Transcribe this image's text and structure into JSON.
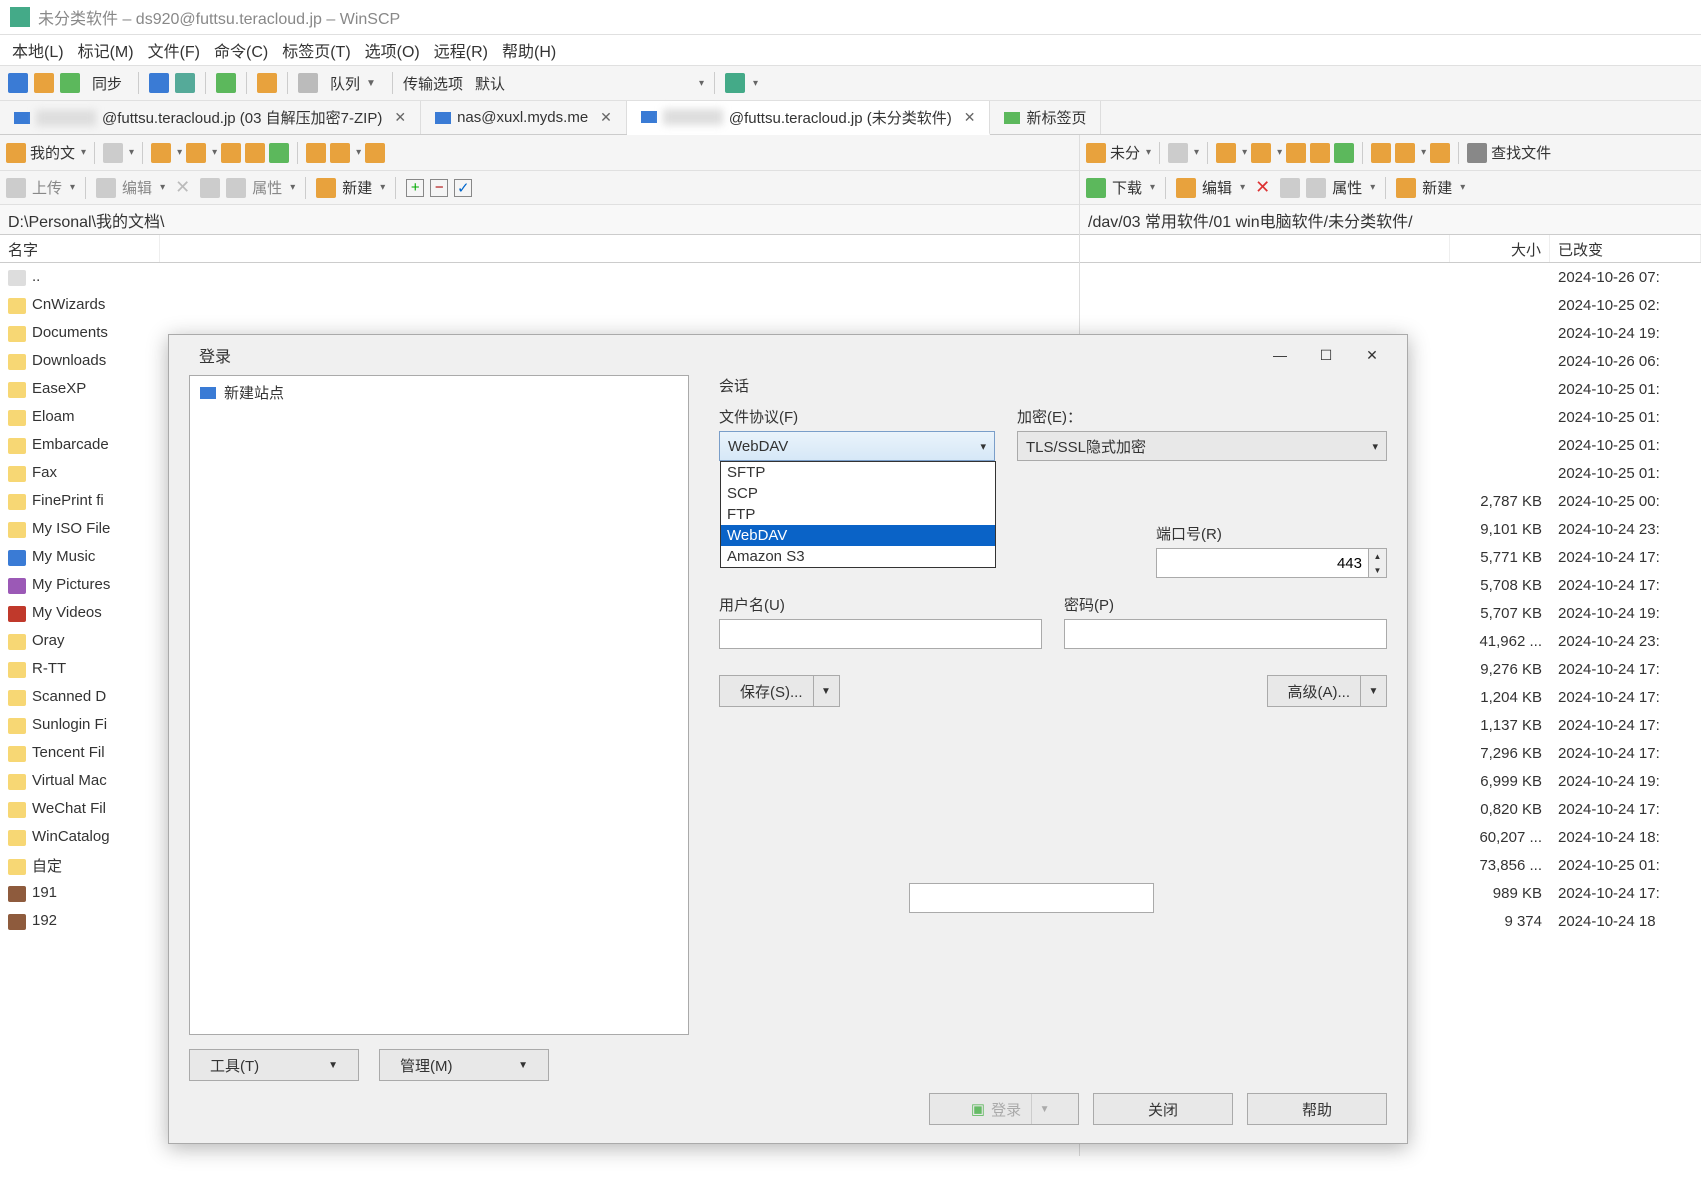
{
  "window": {
    "title": "未分类软件 – ds920@futtsu.teracloud.jp – WinSCP"
  },
  "menu": [
    "本地(L)",
    "标记(M)",
    "文件(F)",
    "命令(C)",
    "标签页(T)",
    "选项(O)",
    "远程(R)",
    "帮助(H)"
  ],
  "toolbar": {
    "sync": "同步",
    "queue": "队列",
    "transfer_opts": "传输选项",
    "transfer_default": "默认"
  },
  "tabs": [
    {
      "label": "@futtsu.teracloud.jp (03 自解压加密7-ZIP)",
      "active": false,
      "closable": true
    },
    {
      "label": "nas@xuxl.myds.me",
      "active": false,
      "closable": true
    },
    {
      "label": "@futtsu.teracloud.jp (未分类软件)",
      "active": true,
      "closable": true
    },
    {
      "label": "新标签页",
      "active": false,
      "closable": false
    }
  ],
  "left": {
    "drive_label": "我的文",
    "upload": "上传",
    "edit": "编辑",
    "props": "属性",
    "new": "新建",
    "path": "D:\\Personal\\我的文档\\",
    "col_name": "名字",
    "files": [
      {
        "name": "..",
        "icon": "up"
      },
      {
        "name": "CnWizards",
        "icon": "folder"
      },
      {
        "name": "Documents",
        "icon": "folder"
      },
      {
        "name": "Downloads",
        "icon": "folder"
      },
      {
        "name": "EaseXP",
        "icon": "folder"
      },
      {
        "name": "Eloam",
        "icon": "folder"
      },
      {
        "name": "Embarcade",
        "icon": "folder"
      },
      {
        "name": "Fax",
        "icon": "folder"
      },
      {
        "name": "FinePrint fi",
        "icon": "folder"
      },
      {
        "name": "My ISO File",
        "icon": "folder"
      },
      {
        "name": "My Music",
        "icon": "music"
      },
      {
        "name": "My Pictures",
        "icon": "img"
      },
      {
        "name": "My Videos",
        "icon": "video"
      },
      {
        "name": "Oray",
        "icon": "folder"
      },
      {
        "name": "R-TT",
        "icon": "folder"
      },
      {
        "name": "Scanned D",
        "icon": "folder"
      },
      {
        "name": "Sunlogin Fi",
        "icon": "folder"
      },
      {
        "name": "Tencent Fil",
        "icon": "folder"
      },
      {
        "name": "Virtual Mac",
        "icon": "folder"
      },
      {
        "name": "WeChat Fil",
        "icon": "folder"
      },
      {
        "name": "WinCatalog",
        "icon": "folder"
      },
      {
        "name": "自定",
        "icon": "folder"
      },
      {
        "name": "191",
        "icon": "jpg"
      },
      {
        "name": "192",
        "icon": "jpg"
      }
    ]
  },
  "right": {
    "drive_label": "未分",
    "find": "查找文件",
    "download": "下载",
    "edit": "编辑",
    "props": "属性",
    "new": "新建",
    "path": "/dav/03 常用软件/01 win电脑软件/未分类软件/",
    "col_size": "大小",
    "col_modified": "已改变",
    "rows": [
      {
        "size": "",
        "modified": "2024-10-26 07:"
      },
      {
        "size": "",
        "modified": "2024-10-25 02:"
      },
      {
        "size": "",
        "modified": "2024-10-24 19:"
      },
      {
        "size": "",
        "modified": "2024-10-26 06:"
      },
      {
        "size": "",
        "modified": "2024-10-25 01:"
      },
      {
        "size": "",
        "modified": "2024-10-25 01:"
      },
      {
        "size": "",
        "modified": "2024-10-25 01:"
      },
      {
        "size": "",
        "modified": "2024-10-25 01:"
      },
      {
        "size": "2,787 KB",
        "modified": "2024-10-25 00:"
      },
      {
        "size": "9,101 KB",
        "modified": "2024-10-24 23:"
      },
      {
        "size": "5,771 KB",
        "modified": "2024-10-24 17:"
      },
      {
        "size": "5,708 KB",
        "modified": "2024-10-24 17:"
      },
      {
        "size": "5,707 KB",
        "modified": "2024-10-24 19:"
      },
      {
        "size": "41,962 ...",
        "modified": "2024-10-24 23:"
      },
      {
        "size": "9,276 KB",
        "modified": "2024-10-24 17:"
      },
      {
        "size": "1,204 KB",
        "modified": "2024-10-24 17:"
      },
      {
        "size": "1,137 KB",
        "modified": "2024-10-24 17:"
      },
      {
        "size": "7,296 KB",
        "modified": "2024-10-24 17:"
      },
      {
        "size": "6,999 KB",
        "modified": "2024-10-24 19:"
      },
      {
        "size": "0,820 KB",
        "modified": "2024-10-24 17:"
      },
      {
        "size": "60,207 ...",
        "modified": "2024-10-24 18:"
      },
      {
        "size": "73,856 ...",
        "modified": "2024-10-25 01:"
      },
      {
        "size": "989 KB",
        "modified": "2024-10-24 17:"
      },
      {
        "size": "9 374",
        "modified": "2024-10-24 18"
      }
    ]
  },
  "dialog": {
    "title": "登录",
    "new_site": "新建站点",
    "session": "会话",
    "protocol_label": "文件协议(F)",
    "protocol_value": "WebDAV",
    "protocol_options": [
      "SFTP",
      "SCP",
      "FTP",
      "WebDAV",
      "Amazon S3"
    ],
    "encryption_label": "加密(E)：",
    "encryption_value": "TLS/SSL隐式加密",
    "port_label": "端口号(R)",
    "port_value": "443",
    "user_label": "用户名(U)",
    "pass_label": "密码(P)",
    "save_btn": "保存(S)...",
    "advanced_btn": "高级(A)...",
    "tools_btn": "工具(T)",
    "manage_btn": "管理(M)",
    "login_btn": "登录",
    "close_btn": "关闭",
    "help_btn": "帮助"
  }
}
